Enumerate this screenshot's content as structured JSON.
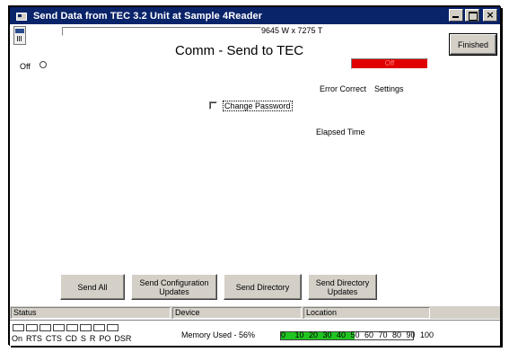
{
  "window": {
    "title": "Send Data from  TEC 3.2 Unit at Sample 4Reader",
    "controls": [
      "minimize",
      "maximize",
      "close"
    ],
    "close_label": "×"
  },
  "header": {
    "size_text": "9645 W x 7275 T",
    "finished_label": "Finished",
    "page_title": "Comm - Send to TEC"
  },
  "status_line": {
    "off_label": "Off",
    "indicator_text": "Off",
    "indicator_color": "#e00000"
  },
  "labels": {
    "error_correct": "Error Correct",
    "settings": "Settings",
    "change_password": "Change Password",
    "elapsed_time": "Elapsed Time"
  },
  "buttons": {
    "send_all": "Send All",
    "send_configuration_updates": "Send Configuration Updates",
    "send_directory": "Send Directory",
    "send_directory_updates": "Send Directory Updates"
  },
  "statusbar": {
    "status": "Status",
    "device": "Device",
    "location": "Location"
  },
  "signals": [
    "On",
    "RTS",
    "CTS",
    "CD",
    "S",
    "R",
    "PO",
    "DSR"
  ],
  "memory": {
    "label": "Memory Used - 56%",
    "percent": 56,
    "ticks": [
      "0",
      "10",
      "20",
      "30",
      "40",
      "50",
      "60",
      "70",
      "80",
      "90",
      "100"
    ],
    "fill_color": "#21c521"
  }
}
